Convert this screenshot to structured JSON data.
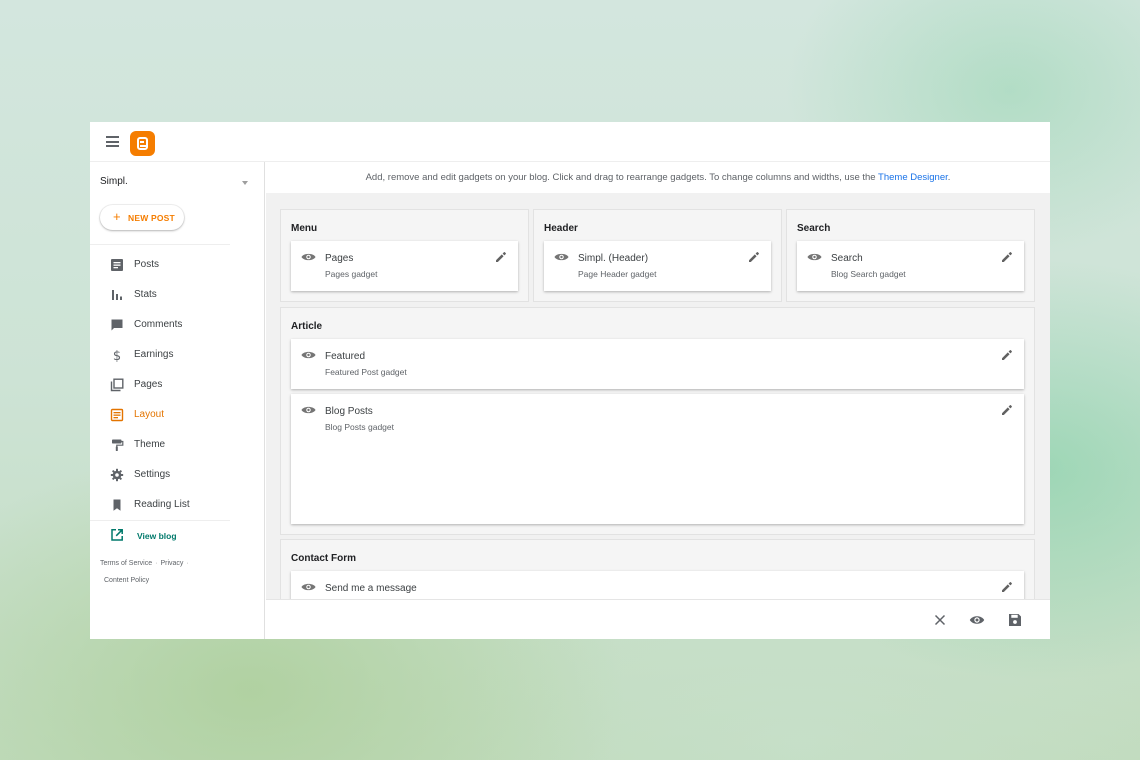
{
  "header": {
    "menu_icon": "hamburger-menu-icon",
    "logo_icon": "blogger-logo-icon",
    "brand_color": "#f57d00"
  },
  "sidebar": {
    "blog_name": "Simpl.",
    "new_post_label": "NEW POST",
    "items": [
      {
        "label": "Posts",
        "icon": "posts-icon",
        "active": false
      },
      {
        "label": "Stats",
        "icon": "stats-icon",
        "active": false
      },
      {
        "label": "Comments",
        "icon": "comments-icon",
        "active": false
      },
      {
        "label": "Earnings",
        "icon": "dollar-icon",
        "active": false
      },
      {
        "label": "Pages",
        "icon": "pages-icon",
        "active": false
      },
      {
        "label": "Layout",
        "icon": "layout-icon",
        "active": true
      },
      {
        "label": "Theme",
        "icon": "paint-roller-icon",
        "active": false
      },
      {
        "label": "Settings",
        "icon": "gear-icon",
        "active": false
      },
      {
        "label": "Reading List",
        "icon": "bookmark-icon",
        "active": false
      }
    ],
    "view_blog_label": "View blog",
    "footer": {
      "terms": "Terms of Service",
      "privacy": "Privacy",
      "content_policy": "Content Policy"
    },
    "active_color": "#e37400"
  },
  "main": {
    "info_text": "Add, remove and edit gadgets on your blog. Click and drag to rearrange gadgets. To change columns and widths, use the",
    "info_link": "Theme Designer",
    "info_end": ".",
    "sections": [
      {
        "title": "Menu",
        "gadgets": [
          {
            "title": "Pages",
            "subtitle": "Pages gadget"
          }
        ]
      },
      {
        "title": "Header",
        "gadgets": [
          {
            "title": "Simpl. (Header)",
            "subtitle": "Page Header gadget"
          }
        ]
      },
      {
        "title": "Search",
        "gadgets": [
          {
            "title": "Search",
            "subtitle": "Blog Search gadget"
          }
        ]
      },
      {
        "title": "Article",
        "gadgets": [
          {
            "title": "Featured",
            "subtitle": "Featured Post gadget"
          },
          {
            "title": "Blog Posts",
            "subtitle": "Blog Posts gadget"
          }
        ]
      },
      {
        "title": "Contact Form",
        "gadgets": [
          {
            "title": "Send me a message",
            "subtitle": ""
          }
        ]
      }
    ]
  },
  "actions": {
    "close_icon": "close-icon",
    "preview_icon": "eye-icon",
    "save_icon": "save-icon"
  }
}
